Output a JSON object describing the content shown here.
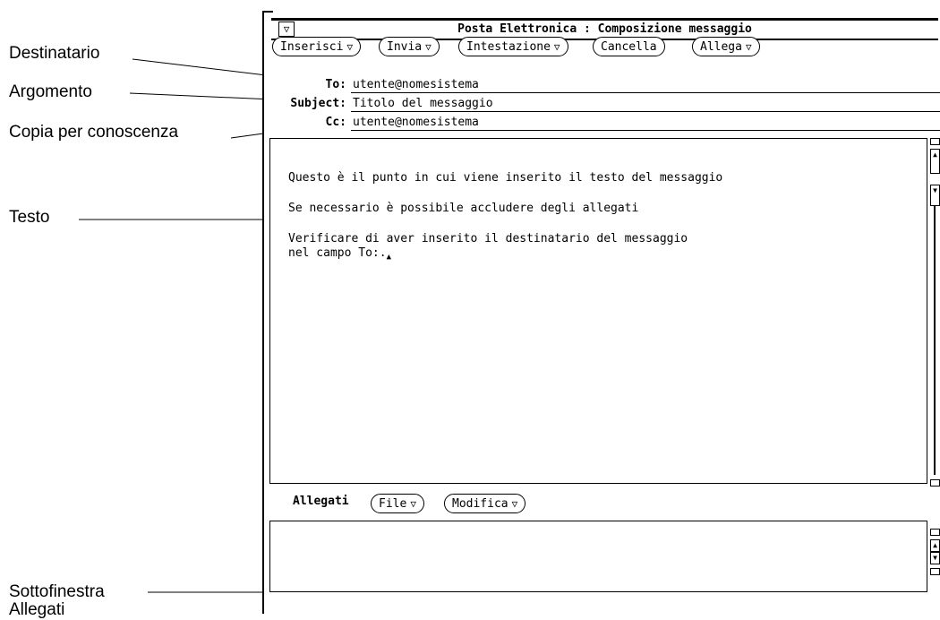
{
  "callouts": {
    "destinatario": "Destinatario",
    "argomento": "Argomento",
    "copia": "Copia per conoscenza",
    "testo": "Testo",
    "sottofinestra_line1": "Sottofinestra",
    "sottofinestra_line2": "Allegati"
  },
  "window": {
    "title": "Posta Elettronica : Composizione messaggio",
    "menu_glyph": "▽"
  },
  "toolbar": {
    "inserisci": "Inserisci",
    "invia": "Invia",
    "intestazione": "Intestazione",
    "cancella": "Cancella",
    "allega": "Allega",
    "menu_glyph": "▽"
  },
  "header": {
    "to_label": "To:",
    "to_value": "utente@nomesistema",
    "subject_label": "Subject:",
    "subject_value": "Titolo del messaggio",
    "cc_label": "Cc:",
    "cc_value": "utente@nomesistema"
  },
  "body": {
    "line1": "Questo è il punto in cui viene inserito il testo del messaggio",
    "line2": "Se necessario è possibile accludere degli allegati",
    "line3": "Verificare di aver inserito il destinatario del messaggio",
    "line4": "nel campo To:."
  },
  "attachments": {
    "label": "Allegati",
    "file_button": "File",
    "modifica_button": "Modifica"
  },
  "icons": {
    "scroll_up": "▲",
    "scroll_down": "▼",
    "caret": "▲"
  }
}
